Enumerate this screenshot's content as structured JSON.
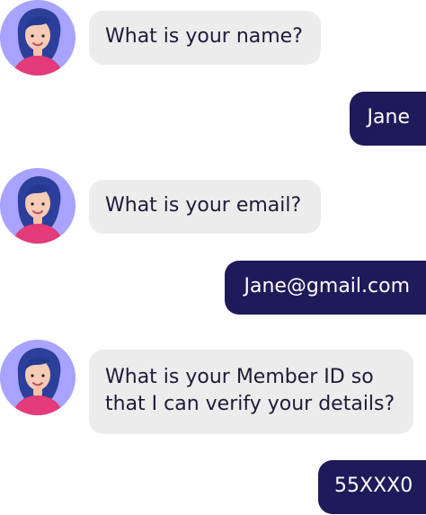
{
  "colors": {
    "avatar_bg": "#a7a3ff",
    "bot_bubble": "#ececec",
    "bot_text": "#1d1b3a",
    "user_bubble": "#1f1a5a",
    "user_text": "#ffffff"
  },
  "chat": {
    "messages": [
      {
        "sender": "bot",
        "text": "What is your name?",
        "avatar_icon": "woman-avatar-icon"
      },
      {
        "sender": "user",
        "text": "Jane"
      },
      {
        "sender": "bot",
        "text": "What is your email?",
        "avatar_icon": "woman-avatar-icon"
      },
      {
        "sender": "user",
        "text": "Jane@gmail.com"
      },
      {
        "sender": "bot",
        "text": "What is your Member ID so\nthat I can verify your details?",
        "avatar_icon": "woman-avatar-icon"
      },
      {
        "sender": "user",
        "text": "55XXX0"
      }
    ]
  }
}
